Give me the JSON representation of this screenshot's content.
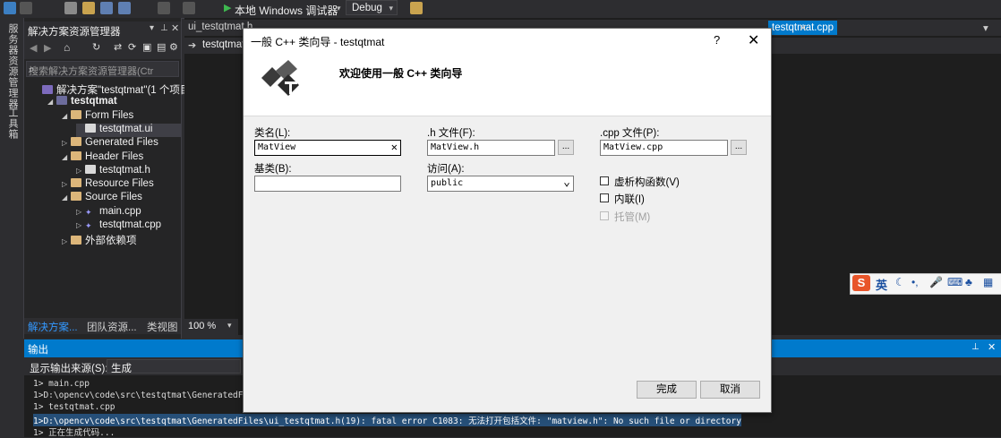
{
  "toolbar": {
    "debug_target": "本地 Windows 调试器",
    "config": "Debug"
  },
  "vstrip": {
    "server_explorer": "服务器资源管理器",
    "toolbox": "工具箱"
  },
  "solution_explorer": {
    "title": "解决方案资源管理器",
    "search_placeholder": "搜索解决方案资源管理器(Ctrl+;)",
    "tree": [
      {
        "label": "解决方案\"testqtmat\"(1 个项目)",
        "indent": 0,
        "twisty": "",
        "icon": "solution"
      },
      {
        "label": "testqtmat",
        "indent": 1,
        "twisty": "◢",
        "icon": "project",
        "bold": true
      },
      {
        "label": "Form Files",
        "indent": 2,
        "twisty": "◢",
        "icon": "folder"
      },
      {
        "label": "testqtmat.ui",
        "indent": 3,
        "twisty": "",
        "icon": "file",
        "selected": true
      },
      {
        "label": "Generated Files",
        "indent": 2,
        "twisty": "▷",
        "icon": "folder"
      },
      {
        "label": "Header Files",
        "indent": 2,
        "twisty": "◢",
        "icon": "folder"
      },
      {
        "label": "testqtmat.h",
        "indent": 3,
        "twisty": "▷",
        "icon": "file"
      },
      {
        "label": "Resource Files",
        "indent": 2,
        "twisty": "▷",
        "icon": "folder"
      },
      {
        "label": "Source Files",
        "indent": 2,
        "twisty": "◢",
        "icon": "folder"
      },
      {
        "label": "main.cpp",
        "indent": 3,
        "twisty": "▷",
        "icon": "cpp"
      },
      {
        "label": "testqtmat.cpp",
        "indent": 3,
        "twisty": "▷",
        "icon": "cpp"
      },
      {
        "label": "外部依赖项",
        "indent": 2,
        "twisty": "▷",
        "icon": "folder"
      }
    ],
    "tabs": [
      "解决方案...",
      "团队资源...",
      "类视图"
    ]
  },
  "editor": {
    "tabs": [
      "ui_testqtmat.h",
      "testqtmat.cpp"
    ],
    "nav_file": "testqtmat",
    "zoom": "100 %"
  },
  "output": {
    "title": "输出",
    "source_label": "显示输出来源(S):",
    "source_value": "生成",
    "lines": [
      "1>  main.cpp",
      "1>D:\\opencv\\code\\src\\testqtmat\\GeneratedFiles",
      "1>  testqtmat.cpp",
      "1>D:\\opencv\\code\\src\\testqtmat\\GeneratedFiles\\ui_testqtmat.h(19): fatal error C1083: 无法打开包括文件: \"matview.h\": No such file or directory",
      "1>  正在生成代码..."
    ]
  },
  "dialog": {
    "title": "一般 C++ 类向导 - testqtmat",
    "help": "?",
    "close": "✕",
    "welcome": "欢迎使用一般 C++ 类向导",
    "class_name_label": "类名(L):",
    "class_name_value": "MatView",
    "h_file_label": ".h 文件(F):",
    "h_file_value": "MatView.h",
    "cpp_file_label": ".cpp 文件(P):",
    "cpp_file_value": "MatView.cpp",
    "base_class_label": "基类(B):",
    "base_class_value": "",
    "access_label": "访问(A):",
    "access_value": "public",
    "browse": "...",
    "virtual_destructor": "虚析构函数(V)",
    "inline": "内联(I)",
    "managed": "托管(M)",
    "finish": "完成",
    "cancel": "取消"
  },
  "ime": {
    "mode": "英"
  }
}
